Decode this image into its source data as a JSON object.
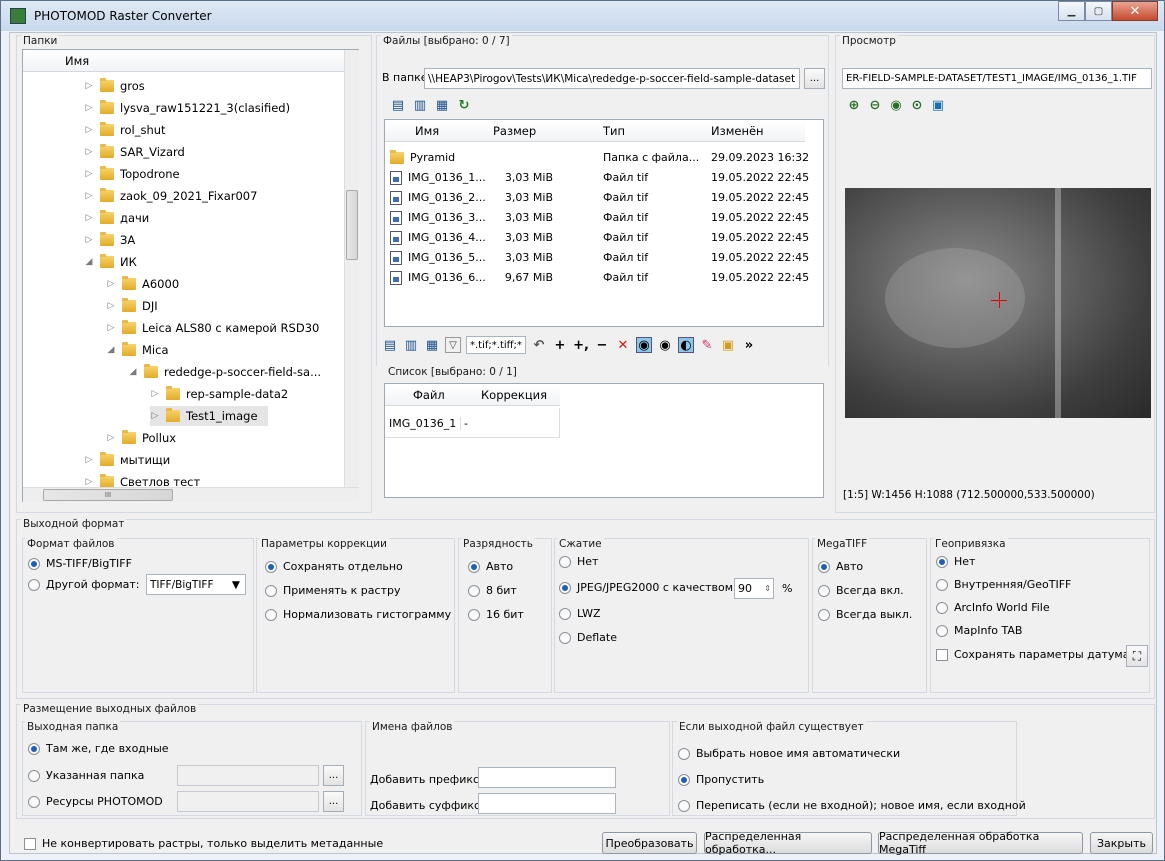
{
  "window": {
    "title": "PHOTOMOD Raster Converter"
  },
  "folders": {
    "label": "Папки",
    "column": "Имя",
    "items": [
      {
        "label": "gros",
        "depth": 3,
        "arrow": "▷"
      },
      {
        "label": "lysva_raw151221_3(clasified)",
        "depth": 3,
        "arrow": "▷"
      },
      {
        "label": "rol_shut",
        "depth": 3,
        "arrow": "▷"
      },
      {
        "label": "SAR_Vizard",
        "depth": 3,
        "arrow": "▷"
      },
      {
        "label": "Topodrone",
        "depth": 3,
        "arrow": "▷"
      },
      {
        "label": "zaok_09_2021_Fixar007",
        "depth": 3,
        "arrow": "▷"
      },
      {
        "label": "дачи",
        "depth": 3,
        "arrow": "▷"
      },
      {
        "label": "ЗА",
        "depth": 3,
        "arrow": "▷"
      },
      {
        "label": "ИК",
        "depth": 3,
        "arrow": "◢"
      },
      {
        "label": "A6000",
        "depth": 4,
        "arrow": "▷"
      },
      {
        "label": "DJI",
        "depth": 4,
        "arrow": "▷"
      },
      {
        "label": "Leica ALS80 с камерой RSD30",
        "depth": 4,
        "arrow": "▷"
      },
      {
        "label": "Mica",
        "depth": 4,
        "arrow": "◢"
      },
      {
        "label": "rededge-p-soccer-field-sa...",
        "depth": 5,
        "arrow": "◢"
      },
      {
        "label": "rep-sample-data2",
        "depth": 6,
        "arrow": "▷"
      },
      {
        "label": "Test1_image",
        "depth": 6,
        "arrow": "▷"
      },
      {
        "label": "Pollux",
        "depth": 4,
        "arrow": "▷"
      },
      {
        "label": "мытищи",
        "depth": 3,
        "arrow": "▷"
      },
      {
        "label": "Светлов тест",
        "depth": 3,
        "arrow": "▷"
      }
    ],
    "hscroll": "III"
  },
  "files": {
    "label": "Файлы [выбрано: 0 / 7]",
    "in_folder_label": "В папке:",
    "path": "\\\\HEAP3\\Pirogov\\Tests\\ИК\\Mica\\rededge-p-soccer-field-sample-dataset",
    "browse": "...",
    "columns": [
      "Имя",
      "Размер",
      "Тип",
      "Изменён"
    ],
    "rows": [
      {
        "name": "Pyramid",
        "size": "",
        "type": "Папка с файла...",
        "date": "29.09.2023 16:32",
        "folder": true
      },
      {
        "name": "IMG_0136_1...",
        "size": "3,03 MiB",
        "type": "Файл tif",
        "date": "19.05.2022 22:45",
        "folder": false
      },
      {
        "name": "IMG_0136_2...",
        "size": "3,03 MiB",
        "type": "Файл tif",
        "date": "19.05.2022 22:45",
        "folder": false
      },
      {
        "name": "IMG_0136_3...",
        "size": "3,03 MiB",
        "type": "Файл tif",
        "date": "19.05.2022 22:45",
        "folder": false
      },
      {
        "name": "IMG_0136_4...",
        "size": "3,03 MiB",
        "type": "Файл tif",
        "date": "19.05.2022 22:45",
        "folder": false
      },
      {
        "name": "IMG_0136_5...",
        "size": "3,03 MiB",
        "type": "Файл tif",
        "date": "19.05.2022 22:45",
        "folder": false
      },
      {
        "name": "IMG_0136_6...",
        "size": "9,67 MiB",
        "type": "Файл tif",
        "date": "19.05.2022 22:45",
        "folder": false
      }
    ],
    "filter": "*.tif;*.tiff;*"
  },
  "list": {
    "label": "Список [выбрано: 0 / 1]",
    "columns": [
      "Файл",
      "Коррекция"
    ],
    "rows": [
      {
        "file": "IMG_0136_1",
        "corr": "-"
      }
    ]
  },
  "preview": {
    "label": "Просмотр",
    "path": "ER-FIELD-SAMPLE-DATASET/TEST1_IMAGE/IMG_0136_1.TIF",
    "status": "[1:5] W:1456 H:1088 (712.500000,533.500000)"
  },
  "output": {
    "label": "Выходной формат",
    "file_format": {
      "label": "Формат файлов",
      "opt1": "MS-TIFF/BigTIFF",
      "opt2": "Другой формат:",
      "select": "TIFF/BigTIFF"
    },
    "correction": {
      "label": "Параметры коррекции",
      "opt1": "Сохранять отдельно",
      "opt2": "Применять к растру",
      "opt3": "Нормализовать гистограмму"
    },
    "depth": {
      "label": "Разрядность",
      "opt1": "Авто",
      "opt2": "8 бит",
      "opt3": "16 бит"
    },
    "compression": {
      "label": "Сжатие",
      "opt1": "Нет",
      "opt2": "JPEG/JPEG2000 с качеством",
      "quality": "90",
      "unit": "%",
      "opt3": "LWZ",
      "opt4": "Deflate"
    },
    "megatiff": {
      "label": "MegaTIFF",
      "opt1": "Авто",
      "opt2": "Всегда вкл.",
      "opt3": "Всегда выкл."
    },
    "georef": {
      "label": "Геопривязка",
      "opt1": "Нет",
      "opt2": "Внутренняя/GeoTIFF",
      "opt3": "ArcInfo World File",
      "opt4": "MapInfo TAB",
      "check": "Сохранять параметры датума"
    }
  },
  "placement": {
    "label": "Размещение выходных файлов",
    "folder": {
      "label": "Выходная папка",
      "opt1": "Там же, где входные",
      "opt2": "Указанная папка",
      "opt3": "Ресурсы PHOTOMOD"
    },
    "names": {
      "label": "Имена файлов",
      "prefix": "Добавить префикс",
      "suffix": "Добавить суффикс"
    },
    "exists": {
      "label": "Если выходной файл существует",
      "opt1": "Выбрать новое имя автоматически",
      "opt2": "Пропустить",
      "opt3": "Переписать (если не входной); новое имя, если входной"
    }
  },
  "bottom": {
    "check": "Не конвертировать растры, только выделить метаданные",
    "convert": "Преобразовать",
    "distributed": "Распределенная обработка...",
    "distributed_mega": "Распределенная обработка MegaTiff",
    "close": "Закрыть"
  }
}
